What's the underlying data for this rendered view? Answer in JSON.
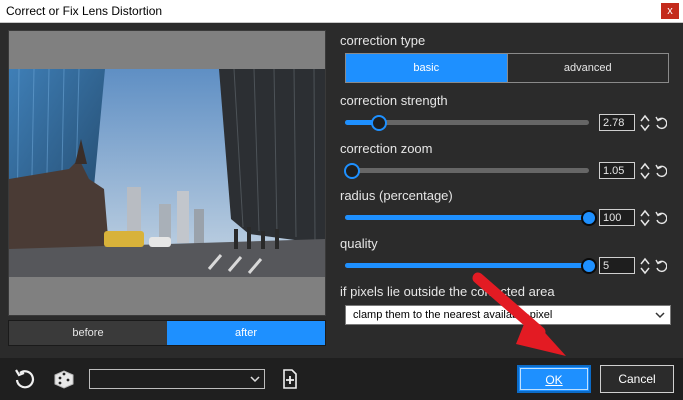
{
  "window": {
    "title": "Correct or Fix Lens Distortion",
    "close_label": "x"
  },
  "preview": {
    "toggle": {
      "before_label": "before",
      "after_label": "after",
      "selected": "after"
    }
  },
  "controls": {
    "correction_type": {
      "label": "correction type",
      "options": [
        "basic",
        "advanced"
      ],
      "selected": "basic"
    },
    "correction_strength": {
      "label": "correction strength",
      "value": "2.78",
      "position_fraction": 0.14
    },
    "correction_zoom": {
      "label": "correction zoom",
      "value": "1.05",
      "position_fraction": 0.03
    },
    "radius": {
      "label": "radius (percentage)",
      "value": "100",
      "position_fraction": 1.0
    },
    "quality": {
      "label": "quality",
      "value": "5",
      "position_fraction": 1.0
    },
    "outside_area": {
      "label": "if pixels lie outside the corrected area",
      "selected": "clamp them to the nearest available pixel"
    }
  },
  "footer": {
    "preset_value": "",
    "ok_label": "OK",
    "cancel_label": "Cancel"
  },
  "colors": {
    "accent": "#1e90ff",
    "background": "#2b2b2b",
    "annotation_arrow": "#e31b23"
  },
  "icons": [
    "reset-icon",
    "dice-icon",
    "chevron-down-icon",
    "new-preset-icon",
    "spin-icon",
    "undo-icon"
  ]
}
